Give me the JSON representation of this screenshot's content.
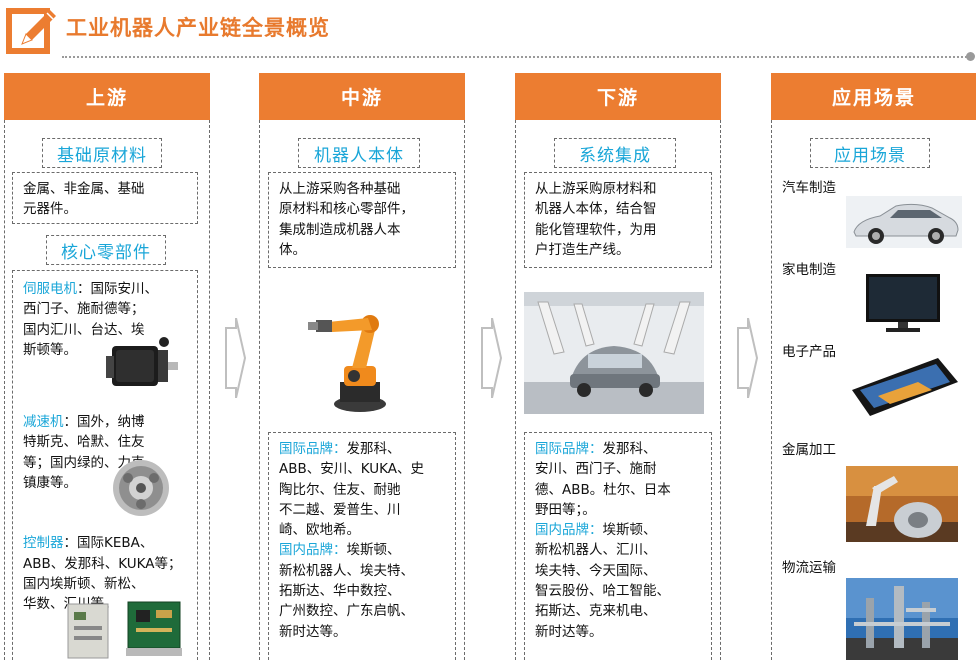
{
  "header": {
    "title": "工业机器人产业链全景概览",
    "logo_icon": "pencil-edit-icon",
    "accent_color": "#ec7d31"
  },
  "columns": {
    "upstream": {
      "title": "上游",
      "materials": {
        "label": "基础原材料",
        "lines": [
          "金属、非金属、基础",
          "元器件。"
        ]
      },
      "components": {
        "label": "核心零部件",
        "servo": {
          "name": "伺服电机",
          "lines": [
            "：国际安川、",
            "西门子、施耐德等；",
            "国内汇川、台达、埃",
            "斯顿等。"
          ]
        },
        "reducer": {
          "name": "减速机",
          "lines": [
            "：国外，纳博",
            "特斯克、哈默、住友",
            "等；国内绿的、力克、",
            "镇康等。"
          ]
        },
        "controller": {
          "name": "控制器",
          "lines": [
            "：国际KEBA、",
            "ABB、发那科、KUKA等；",
            "国内埃斯顿、新松、",
            "华数、汇川等。"
          ]
        }
      }
    },
    "midstream": {
      "title": "中游",
      "label": "机器人本体",
      "desc": [
        "从上游采购各种基础",
        "原材料和核心零部件，",
        "集成制造成机器人本",
        "体。"
      ],
      "intl_label": "国际品牌：",
      "intl_lines": [
        "发那科、",
        "ABB、安川、KUKA、史",
        "陶比尔、住友、耐驰",
        "不二越、爱普生、川",
        "崎、欧地希。"
      ],
      "dom_label": "国内品牌：",
      "dom_lines": [
        "埃斯顿、",
        "新松机器人、埃夫特、",
        "拓斯达、华中数控、",
        "广州数控、广东启帆、",
        "新时达等。"
      ]
    },
    "downstream": {
      "title": "下游",
      "label": "系统集成",
      "desc": [
        "从上游采购原材料和",
        "机器人本体，结合智",
        "能化管理软件，为用",
        "户打造生产线。"
      ],
      "intl_label": "国际品牌：",
      "intl_lines": [
        "发那科、",
        "安川、西门子、施耐",
        "德、ABB。杜尔、日本",
        "野田等；。"
      ],
      "dom_label": "国内品牌：",
      "dom_lines": [
        "埃斯顿、",
        "新松机器人、汇川、",
        "埃夫特、今天国际、",
        "智云股份、哈工智能、",
        "拓斯达、克来机电、",
        "新时达等。"
      ]
    },
    "applications": {
      "title": "应用场景",
      "label": "应用场景",
      "items": [
        "汽车制造",
        "家电制造",
        "电子产品",
        "金属加工",
        "物流运输"
      ]
    }
  }
}
